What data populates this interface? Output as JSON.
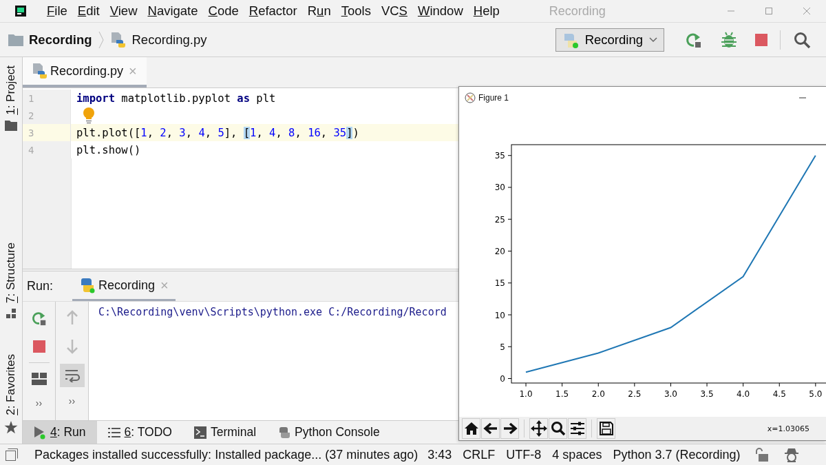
{
  "window": {
    "title": "Recording"
  },
  "menu": [
    {
      "key": "F",
      "post": "ile"
    },
    {
      "key": "E",
      "post": "dit"
    },
    {
      "key": "V",
      "post": "iew"
    },
    {
      "key": "N",
      "post": "avigate"
    },
    {
      "key": "C",
      "post": "ode"
    },
    {
      "key": "R",
      "post": "efactor"
    },
    {
      "pre": "R",
      "key": "u",
      "post": "n"
    },
    {
      "key": "T",
      "post": "ools"
    },
    {
      "pre": "VC",
      "key": "S"
    },
    {
      "key": "W",
      "post": "indow"
    },
    {
      "key": "H",
      "post": "elp"
    }
  ],
  "breadcrumb": [
    {
      "kind": "folder",
      "label": "Recording"
    },
    {
      "kind": "python-file",
      "label": "Recording.py"
    }
  ],
  "run_config": {
    "label": "Recording"
  },
  "tool_windows": [
    {
      "kind": "project",
      "key": "1",
      "label": ": Project"
    },
    {
      "kind": "structure",
      "key": "7",
      "label": ": Structure"
    },
    {
      "kind": "favorites",
      "key": "2",
      "label": ": Favorites"
    }
  ],
  "editor": {
    "tabs": [
      {
        "label": "Recording.py",
        "close": "×",
        "selected": true
      }
    ],
    "lines": [
      {
        "number": "1",
        "current": false,
        "intention": false,
        "tokens": [
          {
            "kind": "keyword",
            "text": "import"
          },
          {
            "kind": "plain",
            "text": " matplotlib.pyplot "
          },
          {
            "kind": "keyword",
            "text": "as"
          },
          {
            "kind": "plain",
            "text": " plt"
          }
        ]
      },
      {
        "number": "2",
        "current": false,
        "intention": true
      },
      {
        "number": "3",
        "current": true,
        "intention": false,
        "tokens": [
          {
            "kind": "plain",
            "text": "plt.plot(["
          },
          {
            "kind": "number",
            "text": "1"
          },
          {
            "kind": "plain",
            "text": ", "
          },
          {
            "kind": "number",
            "text": "2"
          },
          {
            "kind": "plain",
            "text": ", "
          },
          {
            "kind": "number",
            "text": "3"
          },
          {
            "kind": "plain",
            "text": ", "
          },
          {
            "kind": "number",
            "text": "4"
          },
          {
            "kind": "plain",
            "text": ", "
          },
          {
            "kind": "number",
            "text": "5"
          },
          {
            "kind": "plain",
            "text": "], "
          },
          {
            "kind": "match",
            "text": "["
          },
          {
            "kind": "number",
            "text": "1"
          },
          {
            "kind": "plain",
            "text": ", "
          },
          {
            "kind": "number",
            "text": "4"
          },
          {
            "kind": "plain",
            "text": ", "
          },
          {
            "kind": "number",
            "text": "8"
          },
          {
            "kind": "plain",
            "text": ", "
          },
          {
            "kind": "number",
            "text": "16"
          },
          {
            "kind": "plain",
            "text": ", "
          },
          {
            "kind": "number",
            "text": "35"
          },
          {
            "kind": "match",
            "text": "]"
          },
          {
            "kind": "plain",
            "text": ")"
          }
        ]
      },
      {
        "number": "4",
        "current": false,
        "intention": false,
        "tokens": [
          {
            "kind": "plain",
            "text": "plt.show()"
          }
        ]
      }
    ]
  },
  "run": {
    "label": "Run:",
    "tabs": [
      {
        "label": "Recording",
        "close": "×",
        "selected": true
      }
    ],
    "console": [
      "C:\\Recording\\venv\\Scripts\\python.exe C:/Recording/Record"
    ],
    "more_left": "››",
    "more_right": "››",
    "soft_wrap": {
      "on": true
    }
  },
  "bottom_tabs": [
    {
      "kind": "run",
      "key": "4",
      "label": ": Run",
      "selected": true
    },
    {
      "kind": "todo",
      "key": "6",
      "label": ": TODO",
      "selected": false
    },
    {
      "kind": "terminal",
      "label": "Terminal",
      "selected": false
    },
    {
      "kind": "python",
      "label": "Python Console",
      "selected": false
    }
  ],
  "status_bar": {
    "message": "Packages installed successfully: Installed package... (37 minutes ago)",
    "items": [
      "3:43",
      "CRLF",
      "UTF-8",
      "4 spaces",
      "Python 3.7 (Recording)"
    ]
  },
  "figure": {
    "title": "Figure 1",
    "coords": "x=1.03065",
    "chart_data": {
      "type": "line",
      "x": [
        1,
        2,
        3,
        4,
        5
      ],
      "series": [
        {
          "color": "#1f77b4",
          "values": [
            1,
            4,
            8,
            16,
            35
          ]
        }
      ],
      "xlim": [
        0.8,
        5.2
      ],
      "ylim": [
        -0.7,
        36.7
      ],
      "xticks": [
        {
          "value": 1,
          "label": "1.0"
        },
        {
          "value": 1.5,
          "label": "1.5"
        },
        {
          "value": 2,
          "label": "2.0"
        },
        {
          "value": 2.5,
          "label": "2.5"
        },
        {
          "value": 3,
          "label": "3.0"
        },
        {
          "value": 3.5,
          "label": "3.5"
        },
        {
          "value": 4,
          "label": "4.0"
        },
        {
          "value": 4.5,
          "label": "4.5"
        },
        {
          "value": 5,
          "label": "5.0"
        }
      ],
      "yticks": [
        0,
        5,
        10,
        15,
        20,
        25,
        30,
        35
      ]
    }
  }
}
